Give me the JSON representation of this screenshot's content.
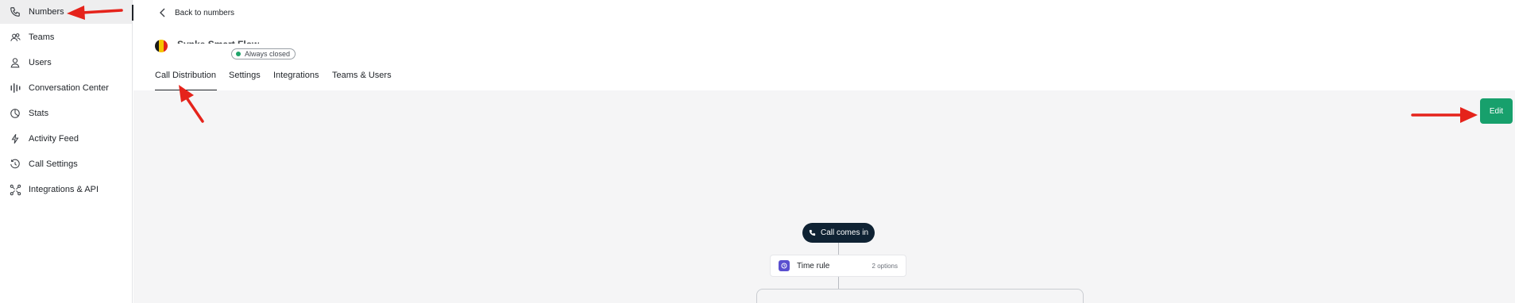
{
  "sidebar": {
    "items": [
      {
        "label": "Numbers",
        "icon": "phone-icon",
        "active": true
      },
      {
        "label": "Teams",
        "icon": "teams-icon",
        "active": false
      },
      {
        "label": "Users",
        "icon": "user-icon",
        "active": false
      },
      {
        "label": "Conversation Center",
        "icon": "waveform-icon",
        "active": false
      },
      {
        "label": "Stats",
        "icon": "stats-icon",
        "active": false
      },
      {
        "label": "Activity Feed",
        "icon": "lightning-icon",
        "active": false
      },
      {
        "label": "Call Settings",
        "icon": "call-settings-icon",
        "active": false
      },
      {
        "label": "Integrations & API",
        "icon": "integrations-icon",
        "active": false
      }
    ]
  },
  "header": {
    "back_label": "Back to numbers",
    "number_name": "Synke Smart Flow",
    "status": "Always closed",
    "flag_colors": [
      "#1a1a1a",
      "#f5c400",
      "#e2231a"
    ]
  },
  "tabs": [
    {
      "label": "Call Distribution",
      "active": true
    },
    {
      "label": "Settings",
      "active": false
    },
    {
      "label": "Integrations",
      "active": false
    },
    {
      "label": "Teams & Users",
      "active": false
    }
  ],
  "toolbar": {
    "edit_label": "Edit"
  },
  "flow": {
    "start_label": "Call comes in",
    "rule_label": "Time rule",
    "rule_options": "2 options"
  },
  "colors": {
    "accent": "#17a06c",
    "pill": "#0f2233",
    "rule_icon": "#5a4fcf",
    "annotation": "#e5231b"
  }
}
